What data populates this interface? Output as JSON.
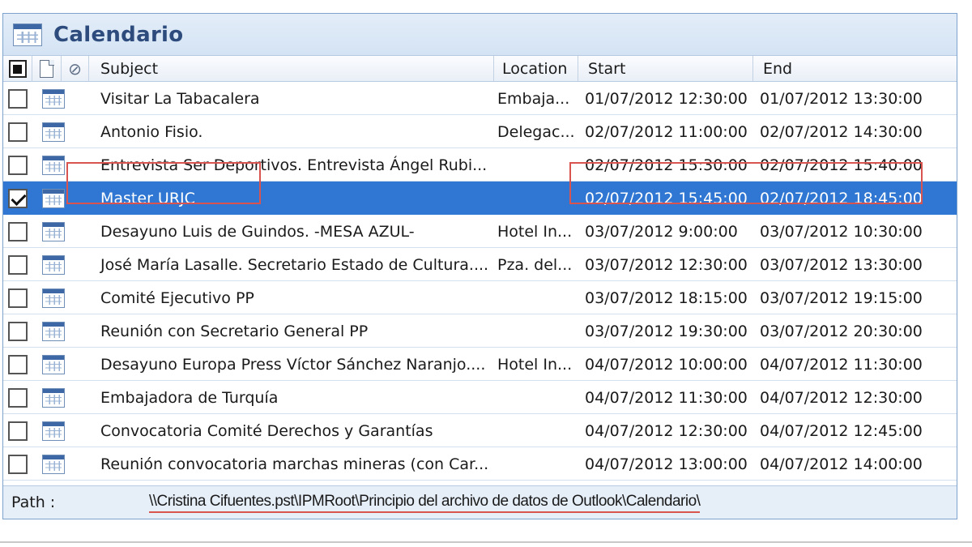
{
  "window": {
    "title": "Calendario"
  },
  "columns": {
    "subject": "Subject",
    "location": "Location",
    "start": "Start",
    "end": "End"
  },
  "rows": [
    {
      "checked": false,
      "subject": "Visitar La Tabacalera",
      "location": "Embaja...",
      "start": "01/07/2012 12:30:00",
      "end": "01/07/2012 13:30:00"
    },
    {
      "checked": false,
      "subject": "Antonio Fisio.",
      "location": "Delegac...",
      "start": "02/07/2012 11:00:00",
      "end": "02/07/2012 14:30:00"
    },
    {
      "checked": false,
      "subject": "Entrevista Ser Deportivos. Entrevista Ángel Rubi...",
      "location": "",
      "start": "02/07/2012 15:30:00",
      "end": "02/07/2012 15:40:00"
    },
    {
      "checked": true,
      "subject": "Master URJC",
      "location": "",
      "start": "02/07/2012 15:45:00",
      "end": "02/07/2012 18:45:00"
    },
    {
      "checked": false,
      "subject": "Desayuno Luis de Guindos.  -MESA AZUL-",
      "location": "Hotel In...",
      "start": "03/07/2012 9:00:00",
      "end": "03/07/2012 10:30:00"
    },
    {
      "checked": false,
      "subject": "José María Lasalle. Secretario Estado de Cultura....",
      "location": "Pza. del...",
      "start": "03/07/2012 12:30:00",
      "end": "03/07/2012 13:30:00"
    },
    {
      "checked": false,
      "subject": "Comité Ejecutivo PP",
      "location": "",
      "start": "03/07/2012 18:15:00",
      "end": "03/07/2012 19:15:00"
    },
    {
      "checked": false,
      "subject": "Reunión con Secretario General PP",
      "location": "",
      "start": "03/07/2012 19:30:00",
      "end": "03/07/2012 20:30:00"
    },
    {
      "checked": false,
      "subject": "Desayuno Europa Press Víctor Sánchez Naranjo....",
      "location": "Hotel In...",
      "start": "04/07/2012 10:00:00",
      "end": "04/07/2012 11:30:00"
    },
    {
      "checked": false,
      "subject": "Embajadora de Turquía",
      "location": "",
      "start": "04/07/2012 11:30:00",
      "end": "04/07/2012 12:30:00"
    },
    {
      "checked": false,
      "subject": "Convocatoria Comité Derechos y Garantías",
      "location": "",
      "start": "04/07/2012 12:30:00",
      "end": "04/07/2012 12:45:00"
    },
    {
      "checked": false,
      "subject": "Reunión convocatoria marchas mineras (con Car...",
      "location": "",
      "start": "04/07/2012 13:00:00",
      "end": "04/07/2012 14:00:00"
    }
  ],
  "path": {
    "label": "Path :",
    "value": "\\\\Cristina Cifuentes.pst\\IPMRoot\\Principio del archivo de datos de Outlook\\Calendario\\"
  },
  "colors": {
    "selection": "#2f77d2",
    "highlight": "#d9534f",
    "title": "#2d4b7c"
  }
}
